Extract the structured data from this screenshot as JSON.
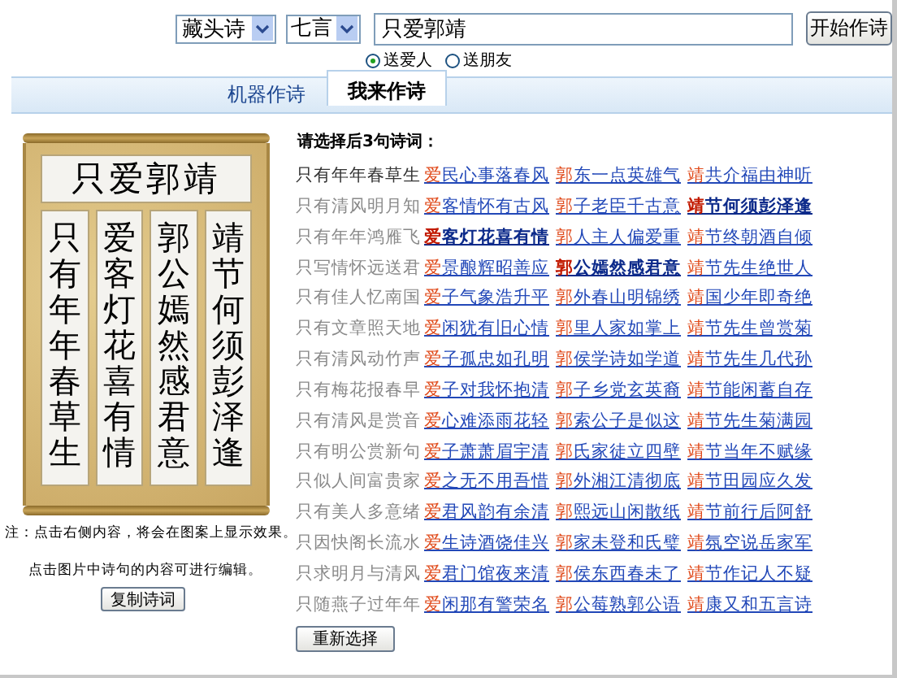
{
  "toolbar": {
    "style_select": "藏头诗",
    "meter_select": "七言",
    "name_input": "只爱郭靖",
    "start_button": "开始作诗",
    "recipients": [
      {
        "label": "送爱人",
        "selected": true
      },
      {
        "label": "送朋友",
        "selected": false
      }
    ]
  },
  "tabs": [
    {
      "label": "机器作诗",
      "selected": false
    },
    {
      "label": "我来作诗",
      "selected": true
    }
  ],
  "scroll": {
    "title": "只爱郭靖",
    "columns": [
      "只有年年春草生",
      "爱客灯花喜有情",
      "郭公嫣然感君意",
      "靖节何须彭泽逢"
    ]
  },
  "notes": [
    "注：点击右侧内容，将会在图案上显示效果。",
    "点击图片中诗句的内容可进行编辑。"
  ],
  "copy_button": "复制诗词",
  "choices": {
    "heading": "请选择后3句诗词：",
    "reset_button": "重新选择",
    "columns": [
      {
        "kind": "plain",
        "lines": [
          {
            "head": "只",
            "rest": "有年年春草生",
            "selected": true
          },
          {
            "head": "只",
            "rest": "有清风明月知",
            "selected": false
          },
          {
            "head": "只",
            "rest": "有年年鸿雁飞",
            "selected": false
          },
          {
            "head": "只",
            "rest": "写情怀远送君",
            "selected": false
          },
          {
            "head": "只",
            "rest": "有佳人忆南国",
            "selected": false
          },
          {
            "head": "只",
            "rest": "有文章照天地",
            "selected": false
          },
          {
            "head": "只",
            "rest": "有清风动竹声",
            "selected": false
          },
          {
            "head": "只",
            "rest": "有梅花报春早",
            "selected": false
          },
          {
            "head": "只",
            "rest": "有清风是赏音",
            "selected": false
          },
          {
            "head": "只",
            "rest": "有明公赏新句",
            "selected": false
          },
          {
            "head": "只",
            "rest": "似人间富贵家",
            "selected": false
          },
          {
            "head": "只",
            "rest": "有美人多意绪",
            "selected": false
          },
          {
            "head": "只",
            "rest": "因快阁长流水",
            "selected": false
          },
          {
            "head": "只",
            "rest": "求明月与清风",
            "selected": false
          },
          {
            "head": "只",
            "rest": "随燕子过年年",
            "selected": false
          }
        ]
      },
      {
        "kind": "link",
        "lines": [
          {
            "head": "爱",
            "rest": "民心事落春风",
            "selected": false
          },
          {
            "head": "爱",
            "rest": "客情怀有古风",
            "selected": false
          },
          {
            "head": "爱",
            "rest": "客灯花喜有情",
            "selected": true
          },
          {
            "head": "爱",
            "rest": "景酿辉昭善应",
            "selected": false
          },
          {
            "head": "爱",
            "rest": "子气象浩升平",
            "selected": false
          },
          {
            "head": "爱",
            "rest": "闲犹有旧心情",
            "selected": false
          },
          {
            "head": "爱",
            "rest": "子孤忠如孔明",
            "selected": false
          },
          {
            "head": "爱",
            "rest": "子对我怀抱清",
            "selected": false
          },
          {
            "head": "爱",
            "rest": "心难添雨花轻",
            "selected": false
          },
          {
            "head": "爱",
            "rest": "子萧萧眉宇清",
            "selected": false
          },
          {
            "head": "爱",
            "rest": "之无不用吾惜",
            "selected": false
          },
          {
            "head": "爱",
            "rest": "君风韵有余清",
            "selected": false
          },
          {
            "head": "爱",
            "rest": "生诗酒饶佳兴",
            "selected": false
          },
          {
            "head": "爱",
            "rest": "君门馆夜来清",
            "selected": false
          },
          {
            "head": "爱",
            "rest": "闲那有警荣名",
            "selected": false
          }
        ]
      },
      {
        "kind": "link",
        "lines": [
          {
            "head": "郭",
            "rest": "东一点英雄气",
            "selected": false
          },
          {
            "head": "郭",
            "rest": "子老臣千古意",
            "selected": false
          },
          {
            "head": "郭",
            "rest": "人主人偏爱重",
            "selected": false
          },
          {
            "head": "郭",
            "rest": "公嫣然感君意",
            "selected": true
          },
          {
            "head": "郭",
            "rest": "外春山明锦绣",
            "selected": false
          },
          {
            "head": "郭",
            "rest": "里人家如掌上",
            "selected": false
          },
          {
            "head": "郭",
            "rest": "侯学诗如学道",
            "selected": false
          },
          {
            "head": "郭",
            "rest": "子乡党玄英裔",
            "selected": false
          },
          {
            "head": "郭",
            "rest": "索公子是似这",
            "selected": false
          },
          {
            "head": "郭",
            "rest": "氏家徒立四壁",
            "selected": false
          },
          {
            "head": "郭",
            "rest": "外湘江清彻底",
            "selected": false
          },
          {
            "head": "郭",
            "rest": "熙远山闲散纸",
            "selected": false
          },
          {
            "head": "郭",
            "rest": "家未登和氏璧",
            "selected": false
          },
          {
            "head": "郭",
            "rest": "侯东西春未了",
            "selected": false
          },
          {
            "head": "郭",
            "rest": "公莓熟郭公语",
            "selected": false
          }
        ]
      },
      {
        "kind": "link",
        "lines": [
          {
            "head": "靖",
            "rest": "共介福由神听",
            "selected": false
          },
          {
            "head": "靖",
            "rest": "节何须彭泽逢",
            "selected": true
          },
          {
            "head": "靖",
            "rest": "节终朝酒自倾",
            "selected": false
          },
          {
            "head": "靖",
            "rest": "节先生绝世人",
            "selected": false
          },
          {
            "head": "靖",
            "rest": "国少年即奇绝",
            "selected": false
          },
          {
            "head": "靖",
            "rest": "节先生曾赏菊",
            "selected": false
          },
          {
            "head": "靖",
            "rest": "节先生几代孙",
            "selected": false
          },
          {
            "head": "靖",
            "rest": "节能闲蓄自存",
            "selected": false
          },
          {
            "head": "靖",
            "rest": "节先生菊满园",
            "selected": false
          },
          {
            "head": "靖",
            "rest": "节当年不赋缘",
            "selected": false
          },
          {
            "head": "靖",
            "rest": "节田园应久发",
            "selected": false
          },
          {
            "head": "靖",
            "rest": "节前行后阿舒",
            "selected": false
          },
          {
            "head": "靖",
            "rest": "氛空说岳家军",
            "selected": false
          },
          {
            "head": "靖",
            "rest": "节作记人不疑",
            "selected": false
          },
          {
            "head": "靖",
            "rest": "康又和五言诗",
            "selected": false
          }
        ]
      }
    ]
  }
}
